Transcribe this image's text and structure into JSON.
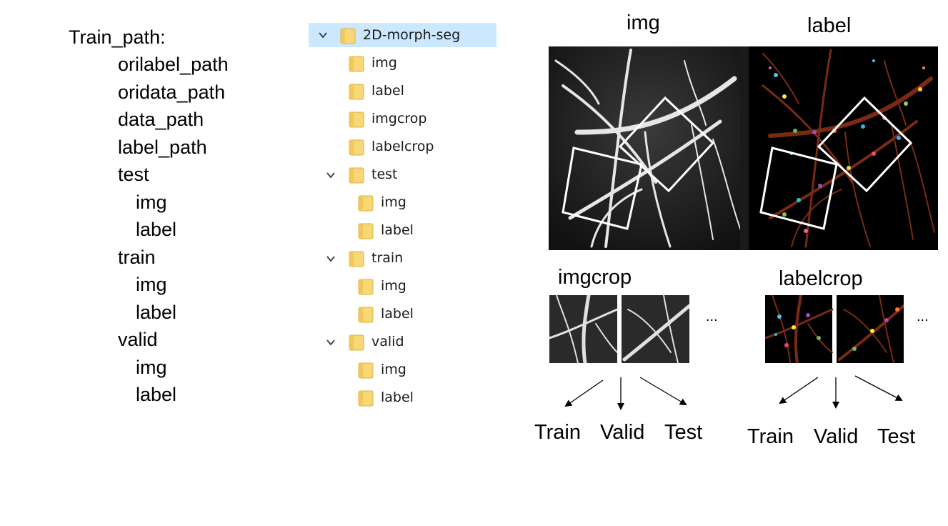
{
  "config_tree": {
    "root": "Train_path:",
    "items": [
      {
        "label": "orilabel_path",
        "level": 1
      },
      {
        "label": "oridata_path",
        "level": 1
      },
      {
        "label": "data_path",
        "level": 1
      },
      {
        "label": "label_path",
        "level": 1
      },
      {
        "label": "test",
        "level": 1
      },
      {
        "label": "img",
        "level": 2
      },
      {
        "label": "label",
        "level": 2
      },
      {
        "label": "train",
        "level": 1
      },
      {
        "label": "img",
        "level": 2
      },
      {
        "label": "label",
        "level": 2
      },
      {
        "label": "valid",
        "level": 1
      },
      {
        "label": "img",
        "level": 2
      },
      {
        "label": "label",
        "level": 2
      }
    ]
  },
  "explorer": {
    "root": "2D-morph-seg",
    "items": [
      {
        "label": "img",
        "expandable": false
      },
      {
        "label": "label",
        "expandable": false
      },
      {
        "label": "imgcrop",
        "expandable": false
      },
      {
        "label": "labelcrop",
        "expandable": false
      },
      {
        "label": "test",
        "expandable": true
      },
      {
        "label": "img",
        "expandable": false
      },
      {
        "label": "label",
        "expandable": false
      },
      {
        "label": "train",
        "expandable": true
      },
      {
        "label": "img",
        "expandable": false
      },
      {
        "label": "label",
        "expandable": false
      },
      {
        "label": "valid",
        "expandable": true
      },
      {
        "label": "img",
        "expandable": false
      },
      {
        "label": "label",
        "expandable": false
      }
    ]
  },
  "figure": {
    "img_title": "img",
    "label_title": "label",
    "imgcrop_title": "imgcrop",
    "labelcrop_title": "labelcrop",
    "ellipsis": "...",
    "splits_left": [
      "Train",
      "Valid",
      "Test"
    ],
    "splits_right": [
      "Train",
      "Valid",
      "Test"
    ]
  },
  "colors": {
    "selection": "#cce8ff",
    "folder": "#f8d775",
    "dendrite_label": "#7a2a12",
    "crop_box": "#ffffff"
  }
}
